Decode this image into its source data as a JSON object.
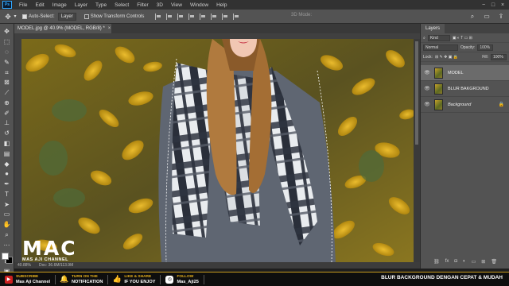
{
  "menu": {
    "logo": "Ps",
    "items": [
      "File",
      "Edit",
      "Image",
      "Layer",
      "Type",
      "Select",
      "Filter",
      "3D",
      "View",
      "Window",
      "Help"
    ],
    "window_controls": [
      "−",
      "□",
      "×"
    ]
  },
  "options_bar": {
    "auto_select_label": "Auto-Select:",
    "auto_select_value": "Layer",
    "show_transform_label": "Show Transform Controls",
    "mode_3d": "3D Mode:"
  },
  "document": {
    "tab_title": "MODEL.jpg @ 40.9% (MODEL, RGB/8) *",
    "close": "×"
  },
  "status": {
    "zoom": "40.88%",
    "doc_info": "Doc: 36.6M/113.9M"
  },
  "layers_panel": {
    "tab": "Layers",
    "kind_label": "Kind",
    "blend_mode": "Normal",
    "opacity_label": "Opacity:",
    "opacity_value": "100%",
    "lock_label": "Lock:",
    "fill_label": "Fill:",
    "fill_value": "100%",
    "layers": [
      {
        "name": "MODEL",
        "active": true
      },
      {
        "name": "BLUR BAKGROUND",
        "active": false
      },
      {
        "name": "Background",
        "active": false,
        "locked": true
      }
    ]
  },
  "branding": {
    "logo_text": "MAC",
    "logo_sub": "MAS AJI CHANNEL"
  },
  "banner": {
    "subscribe_top": "SUBSCRIBE",
    "subscribe_bottom": "Mas Aji Channel",
    "notify_top": "TURN ON THE",
    "notify_bottom": "NOTIFICATION",
    "like_top": "LIKE & SHARE",
    "like_bottom": "IF YOU ENJOY",
    "follow_top": "FOLLOW",
    "follow_bottom": "Mas_Aji25",
    "title": "BLUR BACKGROUND DENGAN CEPAT & MUDAH"
  },
  "colors": {
    "accent": "#e8b21e",
    "ps_blue": "#31a8ff"
  }
}
